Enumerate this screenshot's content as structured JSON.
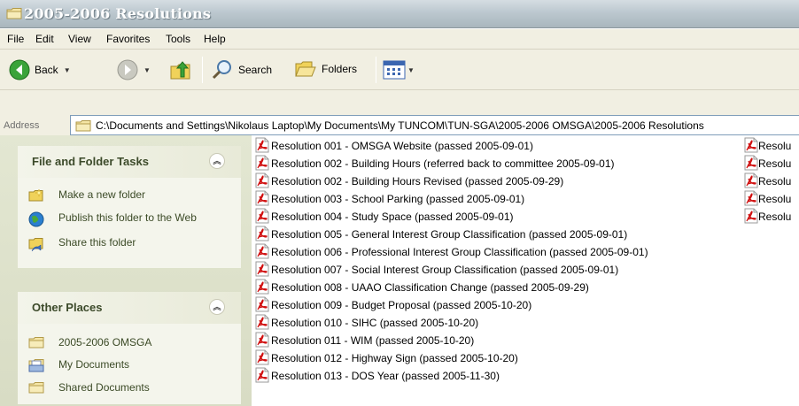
{
  "window": {
    "title": "2005-2006 Resolutions"
  },
  "menu": [
    "File",
    "Edit",
    "View",
    "Favorites",
    "Tools",
    "Help"
  ],
  "toolbar": {
    "back_label": "Back",
    "search_label": "Search",
    "folders_label": "Folders"
  },
  "address": {
    "label": "Address",
    "path": "C:\\Documents and Settings\\Nikolaus Laptop\\My Documents\\My TUNCOM\\TUN-SGA\\2005-2006 OMSGA\\2005-2006 Resolutions"
  },
  "tasks_panel": {
    "title": "File and Folder Tasks",
    "items": [
      "Make a new folder",
      "Publish this folder to the Web",
      "Share this folder"
    ]
  },
  "places_panel": {
    "title": "Other Places",
    "items": [
      "2005-2006 OMSGA",
      "My Documents",
      "Shared Documents"
    ]
  },
  "files": [
    "Resolution 001 - OMSGA Website (passed 2005-09-01)",
    "Resolution 002 - Building Hours  (referred back to committee 2005-09-01)",
    "Resolution 002 - Building Hours Revised (passed 2005-09-29)",
    "Resolution 003 - School Parking  (passed 2005-09-01)",
    "Resolution 004 - Study Space  (passed 2005-09-01)",
    "Resolution 005 - General Interest Group Classification  (passed 2005-09-01)",
    "Resolution 006 - Professional Interest Group Classification  (passed 2005-09-01)",
    "Resolution 007 - Social Interest Group Classification  (passed 2005-09-01)",
    "Resolution 008 - UAAO Classification Change (passed 2005-09-29)",
    "Resolution 009 - Budget Proposal (passed 2005-10-20)",
    "Resolution 010 - SIHC (passed 2005-10-20)",
    "Resolution 011 - WIM (passed 2005-10-20)",
    "Resolution 012 - Highway Sign (passed 2005-10-20)",
    "Resolution 013 - DOS Year (passed 2005-11-30)"
  ],
  "files_col2": [
    "Resolu",
    "Resolu",
    "Resolu",
    "Resolu",
    "Resolu"
  ],
  "colors": {
    "title_text": "#ffffff",
    "address_border": "#7f9db9",
    "pane_bg": "#d8dcc4",
    "panel_title": "#3c4a2a"
  }
}
